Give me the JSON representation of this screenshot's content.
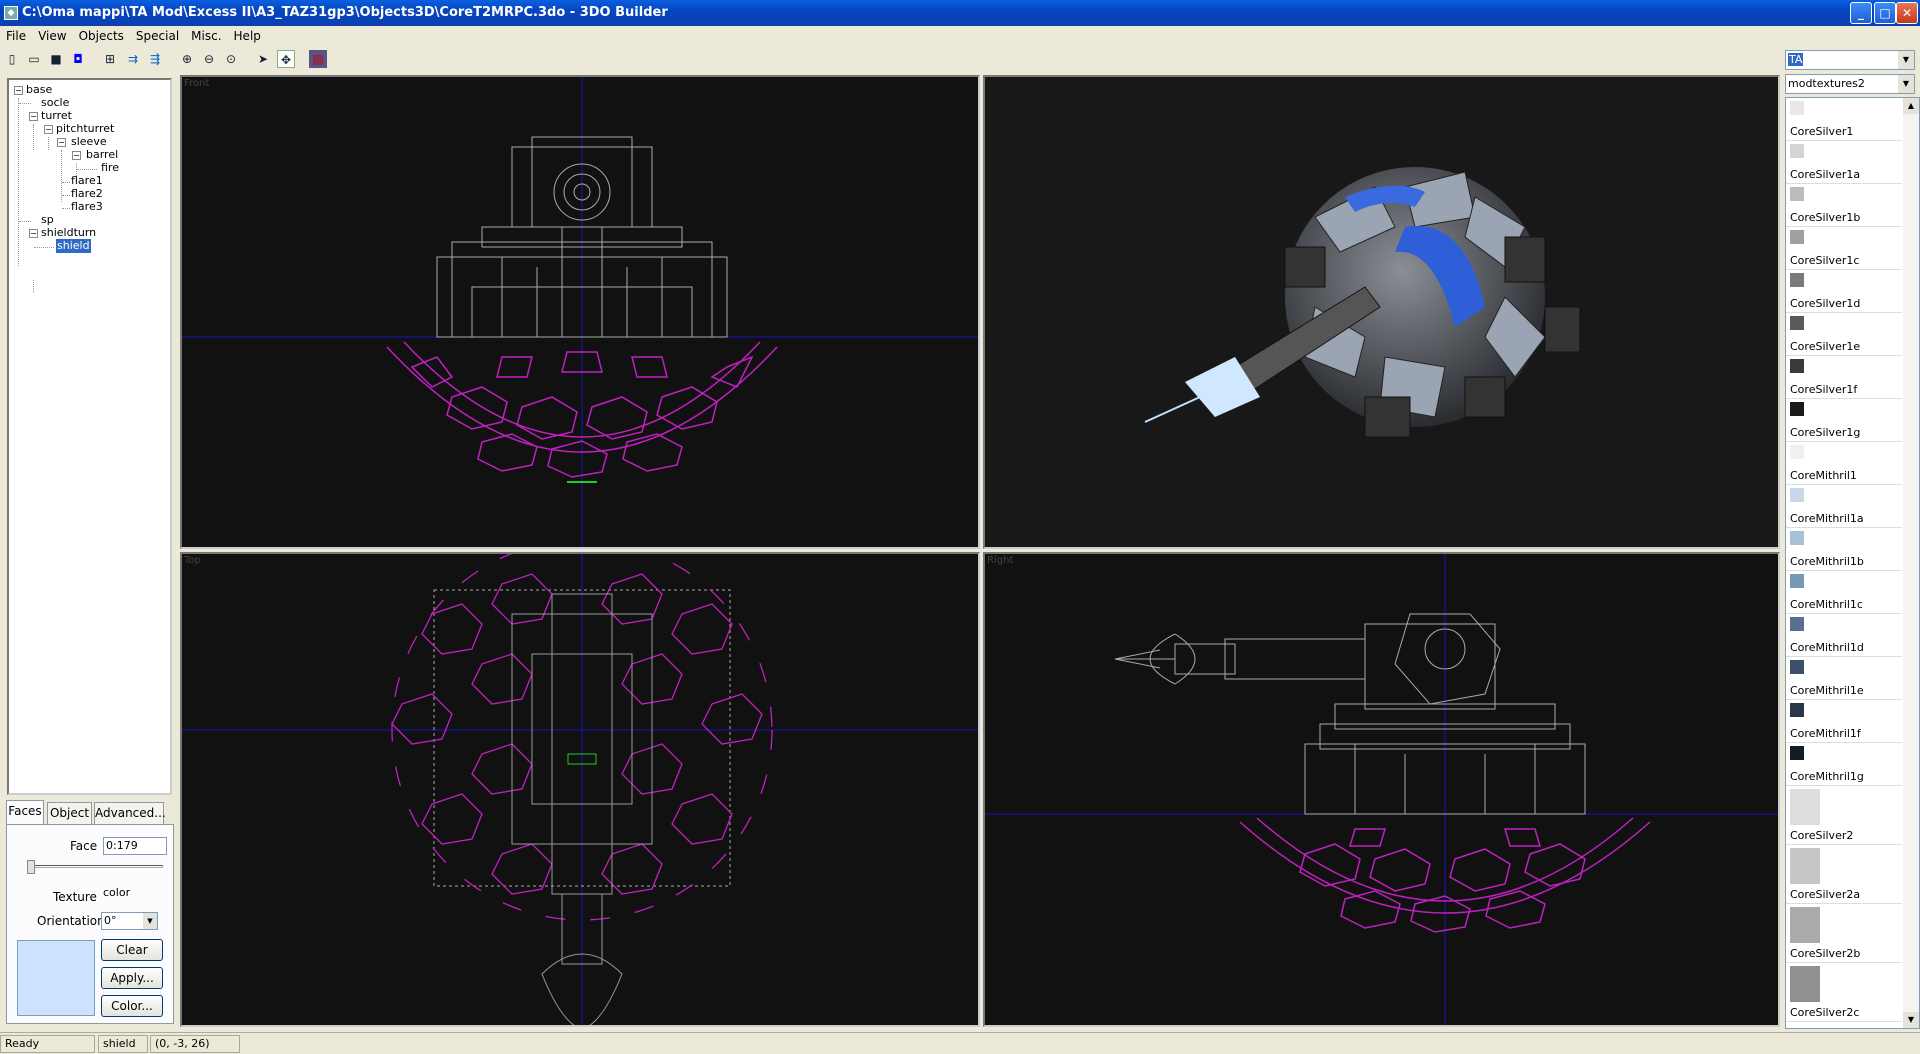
{
  "window": {
    "title": "C:\\Oma mappi\\TA Mod\\Excess II\\A3_TAZ31gp3\\Objects3D\\CoreT2MRPC.3do - 3DO Builder"
  },
  "menu": [
    "File",
    "View",
    "Objects",
    "Special",
    "Misc.",
    "Help"
  ],
  "tree": [
    {
      "label": "base",
      "depth": 0,
      "expander": "-"
    },
    {
      "label": "socle",
      "depth": 1,
      "expander": ""
    },
    {
      "label": "turret",
      "depth": 1,
      "expander": "-"
    },
    {
      "label": "pitchturret",
      "depth": 2,
      "expander": "-"
    },
    {
      "label": "sleeve",
      "depth": 3,
      "expander": "-"
    },
    {
      "label": "barrel",
      "depth": 4,
      "expander": "-"
    },
    {
      "label": "fire",
      "depth": 5,
      "expander": ""
    },
    {
      "label": "flare1",
      "depth": 3,
      "expander": ""
    },
    {
      "label": "flare2",
      "depth": 3,
      "expander": ""
    },
    {
      "label": "flare3",
      "depth": 3,
      "expander": ""
    },
    {
      "label": "sp",
      "depth": 1,
      "expander": ""
    },
    {
      "label": "shieldturn",
      "depth": 1,
      "expander": "-"
    },
    {
      "label": "shield",
      "depth": 2,
      "expander": "",
      "selected": true
    }
  ],
  "tabs": [
    "Faces",
    "Object",
    "Advanced..."
  ],
  "faces": {
    "face_label": "Face",
    "face_value": "0:179",
    "texture_label": "Texture",
    "texture_value": "color",
    "orientation_label": "Orientation",
    "orientation_value": "0°",
    "clear": "Clear",
    "apply": "Apply...",
    "color": "Color...",
    "swatch_color": "#cde2ff"
  },
  "viewports": {
    "front": "Front",
    "top": "Top",
    "right": "Right"
  },
  "right_panel": {
    "palette": "TA",
    "texture_set": "modtextures2",
    "textures": [
      {
        "name": "CoreSilver1",
        "color": "#e8e8e8"
      },
      {
        "name": "CoreSilver1a",
        "color": "#d4d4d4"
      },
      {
        "name": "CoreSilver1b",
        "color": "#bcbcbc"
      },
      {
        "name": "CoreSilver1c",
        "color": "#a0a0a0"
      },
      {
        "name": "CoreSilver1d",
        "color": "#7a7a7a"
      },
      {
        "name": "CoreSilver1e",
        "color": "#5a5a5a"
      },
      {
        "name": "CoreSilver1f",
        "color": "#3a3a3a"
      },
      {
        "name": "CoreSilver1g",
        "color": "#1a1a1a"
      },
      {
        "name": "CoreMithril1",
        "color": "#f0f0f4"
      },
      {
        "name": "CoreMithril1a",
        "color": "#c8d8e8"
      },
      {
        "name": "CoreMithril1b",
        "color": "#a8c0d8"
      },
      {
        "name": "CoreMithril1c",
        "color": "#7898b8"
      },
      {
        "name": "CoreMithril1d",
        "color": "#587090"
      },
      {
        "name": "CoreMithril1e",
        "color": "#3c5068"
      },
      {
        "name": "CoreMithril1f",
        "color": "#283848"
      },
      {
        "name": "CoreMithril1g",
        "color": "#141c24"
      },
      {
        "name": "CoreSilver2",
        "color": "#dddddd"
      },
      {
        "name": "CoreSilver2a",
        "color": "#c6c6c6"
      },
      {
        "name": "CoreSilver2b",
        "color": "#aaaaaa"
      },
      {
        "name": "CoreSilver2c",
        "color": "#909090"
      }
    ]
  },
  "status": {
    "ready": "Ready",
    "object": "shield",
    "coords": "(0, -3, 26)"
  }
}
